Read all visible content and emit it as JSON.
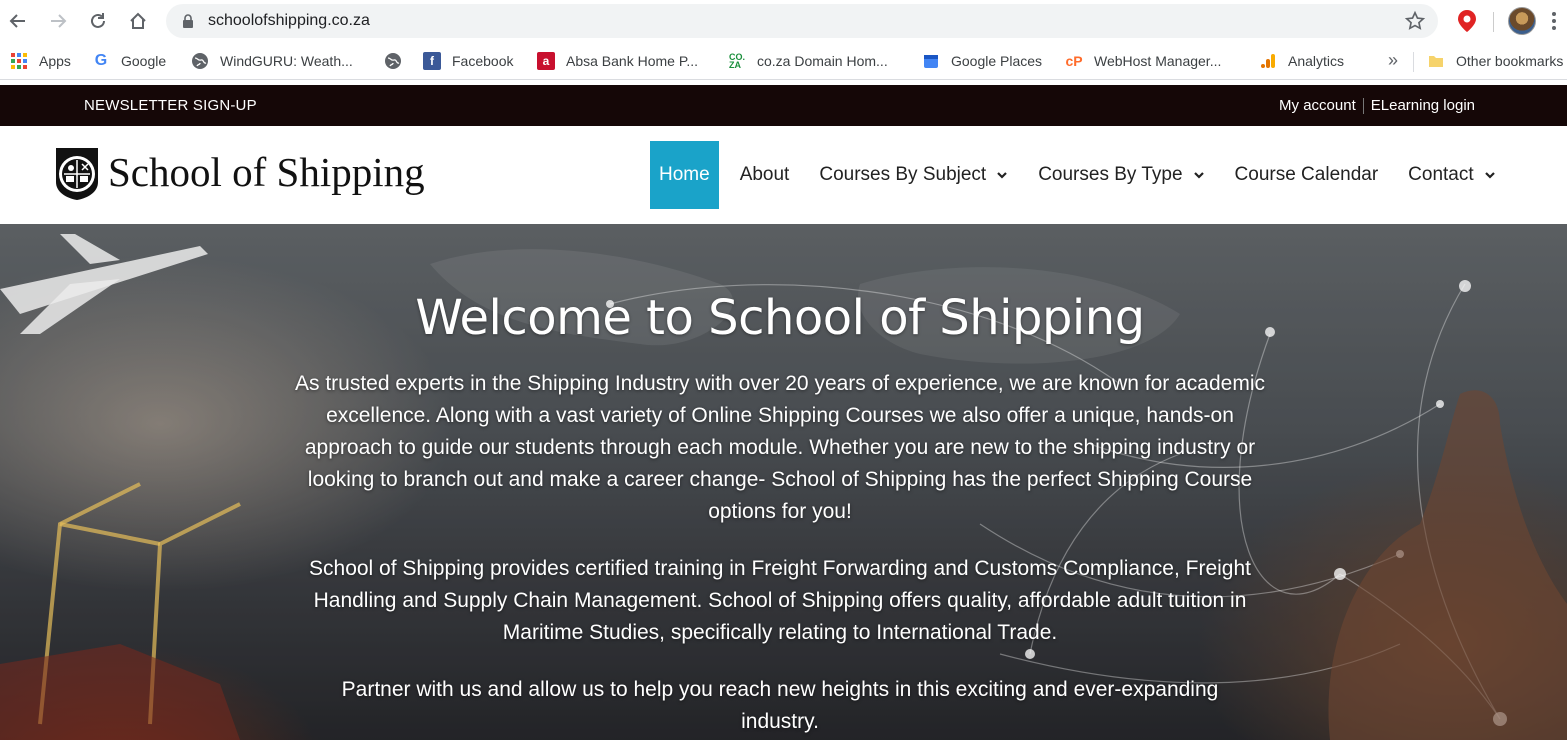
{
  "browser": {
    "url": "schoolofshipping.co.za",
    "bookmarks": [
      {
        "label": "Apps",
        "icon": "apps-grid-icon"
      },
      {
        "label": "Google",
        "icon": "google-icon"
      },
      {
        "label": "WindGURU: Weath...",
        "icon": "globe-icon"
      },
      {
        "label": "",
        "icon": "globe-icon"
      },
      {
        "label": "Facebook",
        "icon": "facebook-icon"
      },
      {
        "label": "Absa Bank Home P...",
        "icon": "absa-icon"
      },
      {
        "label": "co.za Domain Hom...",
        "icon": "coza-icon"
      },
      {
        "label": "Google Places",
        "icon": "google-places-icon"
      },
      {
        "label": "WebHost Manager...",
        "icon": "cpanel-icon"
      },
      {
        "label": "Analytics",
        "icon": "analytics-icon"
      }
    ],
    "more_label": "»",
    "other_bookmarks": "Other bookmarks"
  },
  "topbar": {
    "newsletter": "NEWSLETTER SIGN-UP",
    "my_account": "My account",
    "elearning": "ELearning login"
  },
  "header": {
    "logo_text": "School of Shipping",
    "menu": [
      {
        "label": "Home",
        "active": true,
        "dropdown": false
      },
      {
        "label": "About",
        "active": false,
        "dropdown": false
      },
      {
        "label": "Courses By Subject",
        "active": false,
        "dropdown": true
      },
      {
        "label": "Courses By Type",
        "active": false,
        "dropdown": true
      },
      {
        "label": "Course Calendar",
        "active": false,
        "dropdown": false
      },
      {
        "label": "Contact",
        "active": false,
        "dropdown": true
      }
    ],
    "accent": "#1aa3c9"
  },
  "hero": {
    "title": "Welcome to School of Shipping",
    "paragraphs": [
      "As trusted experts in the Shipping Industry with over 20 years of experience, we are known for academic excellence. Along with a vast variety of Online Shipping Courses we also offer a unique, hands-on approach to guide our students through each module. Whether you are new to the shipping industry or looking to branch out and make a career change- School of Shipping has the perfect Shipping Course options for you!",
      "School of Shipping provides certified training in Freight Forwarding and Customs Compliance, Freight Handling and Supply Chain Management. School of Shipping offers quality, affordable adult tuition in Maritime Studies, specifically relating to International Trade.",
      "Partner with us and allow us to help you reach new heights in this exciting and ever-expanding industry."
    ]
  }
}
